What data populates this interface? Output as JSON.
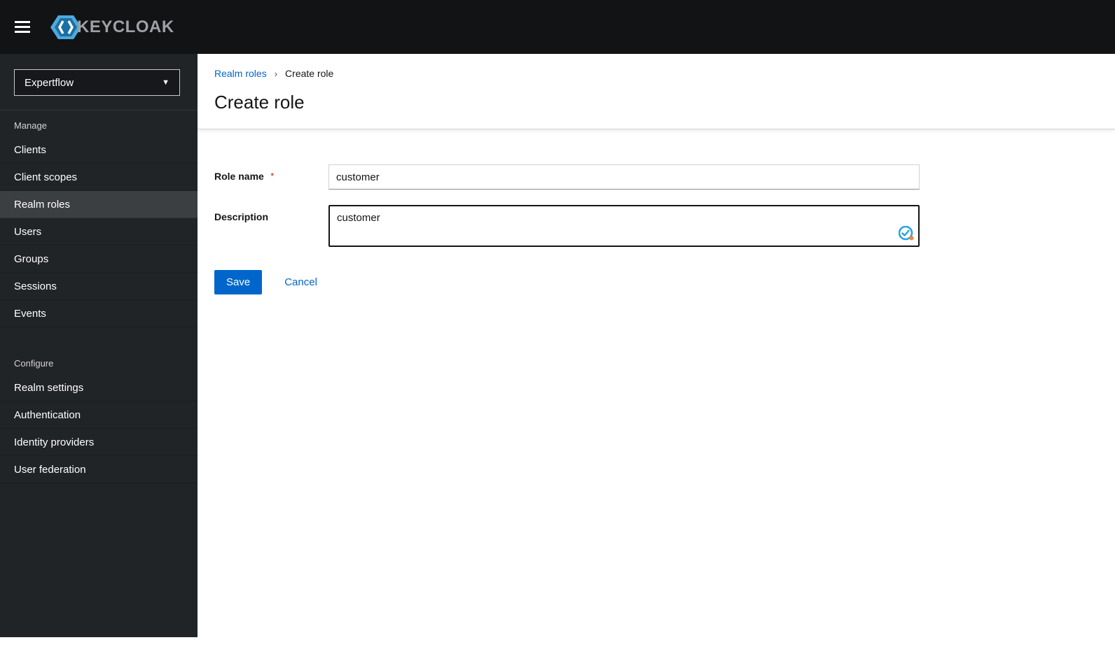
{
  "header": {
    "logo_text": "KEYCLOAK"
  },
  "sidebar": {
    "realm_selector": {
      "value": "Expertflow"
    },
    "sections": [
      {
        "label": "Manage",
        "items": [
          "Clients",
          "Client scopes",
          "Realm roles",
          "Users",
          "Groups",
          "Sessions",
          "Events"
        ]
      },
      {
        "label": "Configure",
        "items": [
          "Realm settings",
          "Authentication",
          "Identity providers",
          "User federation"
        ]
      }
    ],
    "selected_item": "Realm roles"
  },
  "breadcrumb": {
    "items": [
      "Realm roles",
      "Create role"
    ],
    "separator": "›"
  },
  "page": {
    "title": "Create role"
  },
  "form": {
    "role_name": {
      "label": "Role name",
      "required_marker": "*",
      "value": "customer"
    },
    "description": {
      "label": "Description",
      "value": "customer"
    },
    "actions": {
      "save_label": "Save",
      "cancel_label": "Cancel"
    }
  },
  "colors": {
    "accent_blue": "#0066cc",
    "required_red": "#c9190b",
    "header_bg": "#121315",
    "sidebar_bg": "#212427",
    "selected_item_bg": "#3c3f42",
    "logo_text_gray": "#9ea1a4"
  }
}
